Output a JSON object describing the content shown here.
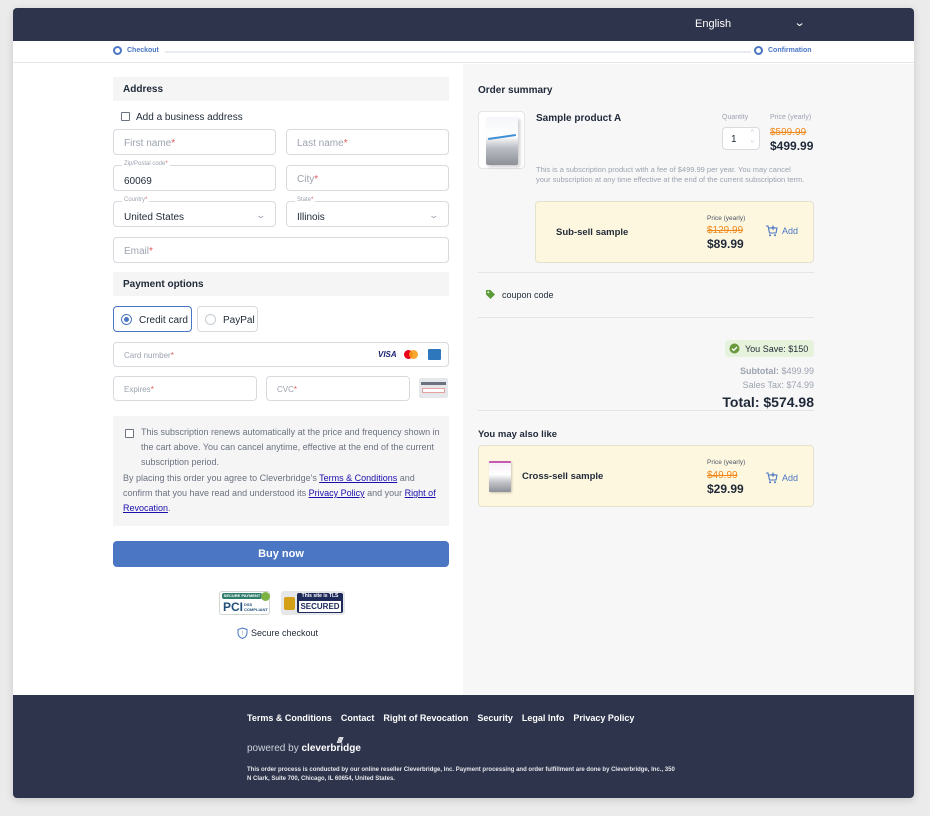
{
  "header": {
    "language": "English",
    "language_icon": "chevron-down-icon"
  },
  "progress": {
    "steps": [
      {
        "label": "Checkout"
      },
      {
        "label": "Confirmation"
      }
    ]
  },
  "address": {
    "title": "Address",
    "business_checkbox_label": "Add a business address",
    "first_name_placeholder": "First name",
    "last_name_placeholder": "Last name",
    "zip_label": "Zip/Postal code",
    "zip_value": "60069",
    "city_placeholder": "City",
    "country_label": "Country",
    "country_value": "United States",
    "state_label": "State",
    "state_value": "Illinois",
    "email_placeholder": "Email",
    "required_mark": "*"
  },
  "payment": {
    "title": "Payment options",
    "options": [
      {
        "label": "Credit card",
        "selected": true
      },
      {
        "label": "PayPal",
        "selected": false
      }
    ],
    "card_number_placeholder": "Card number",
    "expires_placeholder": "Expires",
    "cvc_placeholder": "CVC",
    "card_brands": [
      "VISA",
      "Mastercard",
      "American Express"
    ]
  },
  "legal": {
    "subscription_text": "This subscription renews automatically at the price and frequency shown in the cart above. You can cancel anytime, effective at the end of the current subscription period.",
    "agree_prefix": "By placing this order you agree to Cleverbridge's ",
    "terms_link": "Terms & Conditions",
    "agree_mid": " and confirm that you have read and understood its ",
    "privacy_link": "Privacy Policy",
    "agree_mid2": " and your ",
    "revocation_link": "Right of Revocation",
    "agree_end": "."
  },
  "buy_button": "Buy now",
  "badges": {
    "pci_top": "SECURE PAYMENT",
    "pci_main": "PCI",
    "pci_sub": "DSS COMPLIANT",
    "tls_top": "This site is TLS",
    "tls_main": "SECURED"
  },
  "secure_checkout": "Secure checkout",
  "summary": {
    "title": "Order summary",
    "product": {
      "name": "Sample product A",
      "quantity_label": "Quantity",
      "quantity": "1",
      "price_label": "Price (yearly)",
      "old_price": "$599.99",
      "price": "$499.99",
      "description": "This is a subscription product with a fee of $499.99 per year. You may cancel your subscription at any time effective at the end of the current subscription term."
    },
    "subsell": {
      "name": "Sub-sell sample",
      "price_label": "Price (yearly)",
      "old_price": "$129.99",
      "price": "$89.99",
      "add_label": "Add"
    },
    "coupon_label": "coupon code",
    "you_save": "You Save: $150",
    "subtotal_label": "Subtotal:",
    "subtotal": "$499.99",
    "tax_label": "Sales Tax:",
    "tax": "$74.99",
    "total_label": "Total:",
    "total": "$574.98"
  },
  "also_like": {
    "title": "You may also like",
    "item": {
      "name": "Cross-sell sample",
      "price_label": "Price (yearly)",
      "old_price": "$49.99",
      "price": "$29.99",
      "add_label": "Add"
    }
  },
  "footer": {
    "links": [
      "Terms & Conditions",
      "Contact",
      "Right of Revocation",
      "Security",
      "Legal Info",
      "Privacy Policy"
    ],
    "powered_by": "powered by",
    "brand": "cleverbridge",
    "text": "This order process is conducted by our online reseller Cleverbridge, Inc. Payment processing and order fulfillment are done by Cleverbridge, Inc., 350 N Clark, Suite 700, Chicago, IL 60654, United States."
  },
  "colors": {
    "accent": "#4a76c4",
    "header_bg": "#2d344c",
    "strike": "#f0891b",
    "upsell_bg": "#fef7e0",
    "save_bg": "#e6f2dc"
  }
}
